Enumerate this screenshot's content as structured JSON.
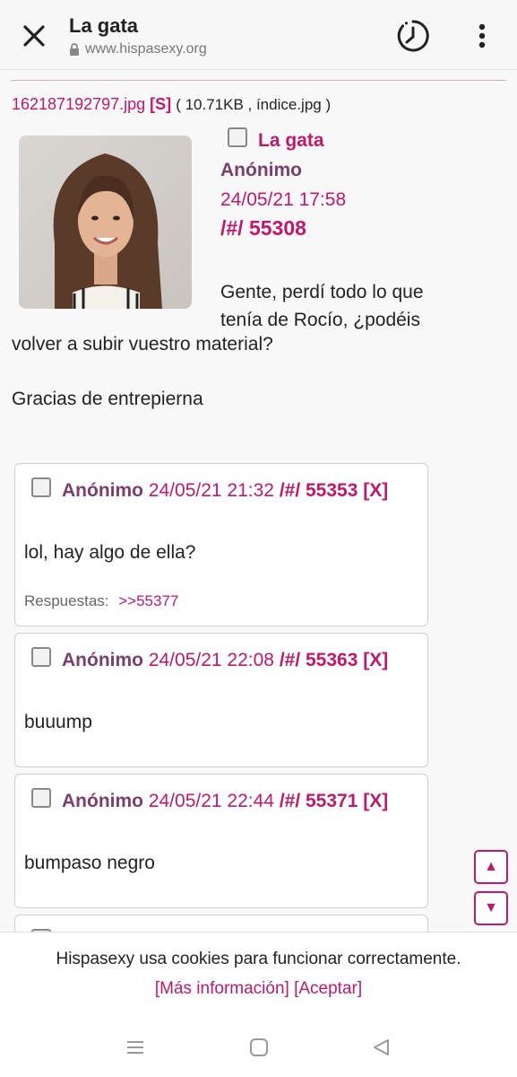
{
  "browser": {
    "title": "La gata",
    "url": "www.hispasexy.org"
  },
  "op": {
    "filename": "162187192797.jpg",
    "s_link": "[S]",
    "file_meta": "( 10.71KB , índice.jpg )",
    "subject": "La gata",
    "name": "Anónimo",
    "date": "24/05/21 17:58",
    "post_no": "/#/ 55308",
    "body_line1": "Gente, perdí todo lo que",
    "body_line2": "tenía de Rocío, ¿podéis",
    "body_line3": "volver a subir vuestro material?",
    "body_line4": "Gracias de entrepierna"
  },
  "replies": [
    {
      "name": "Anónimo",
      "date": "24/05/21 21:32",
      "post_no": "/#/ 55353",
      "delete": "[X]",
      "text": "lol, hay algo de ella?",
      "responses_label": "Respuestas:",
      "responses_link": ">>55377"
    },
    {
      "name": "Anónimo",
      "date": "24/05/21 22:08",
      "post_no": "/#/ 55363",
      "delete": "[X]",
      "text": "buuump"
    },
    {
      "name": "Anónimo",
      "date": "24/05/21 22:44",
      "post_no": "/#/ 55371",
      "delete": "[X]",
      "text": "bumpaso negro"
    }
  ],
  "scroll": {
    "up": "▲",
    "down": "▼"
  },
  "cookie": {
    "message": "Hispasexy usa cookies para funcionar correctamente.",
    "more_info": "[Más información]",
    "accept": "[Aceptar]"
  },
  "colors": {
    "accent": "#c2186b",
    "name": "#7a3f6a"
  }
}
